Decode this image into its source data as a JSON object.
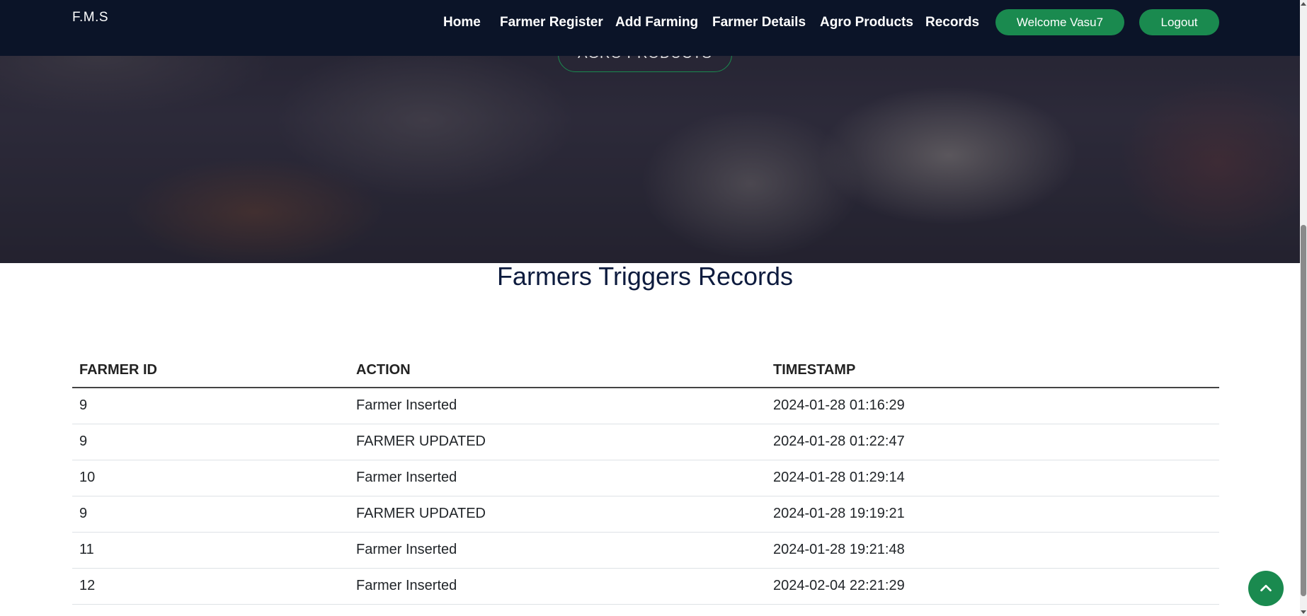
{
  "navbar": {
    "brand": "F.M.S",
    "links": [
      "Home",
      "Farmer Register",
      "Add Farming",
      "Farmer Details",
      "Agro Products",
      "Records"
    ],
    "welcome": "Welcome Vasu7",
    "logout": "Logout"
  },
  "hero": {
    "button_label": "AGRO PRODUCTS"
  },
  "records": {
    "title": "Farmers Triggers Records",
    "columns": [
      "FARMER ID",
      "ACTION",
      "TIMESTAMP"
    ],
    "rows": [
      [
        "9",
        "Farmer Inserted",
        "2024-01-28 01:16:29"
      ],
      [
        "9",
        "FARMER UPDATED",
        "2024-01-28 01:22:47"
      ],
      [
        "10",
        "Farmer Inserted",
        "2024-01-28 01:29:14"
      ],
      [
        "9",
        "FARMER UPDATED",
        "2024-01-28 19:19:21"
      ],
      [
        "11",
        "Farmer Inserted",
        "2024-01-28 19:21:48"
      ],
      [
        "12",
        "Farmer Inserted",
        "2024-02-04 22:21:29"
      ]
    ]
  },
  "colors": {
    "navbar": "#0b1428",
    "accent_green": "#1a8a4f",
    "title": "#0d1b3e"
  },
  "icons": {
    "back_to_top": "chevron-up-icon"
  }
}
